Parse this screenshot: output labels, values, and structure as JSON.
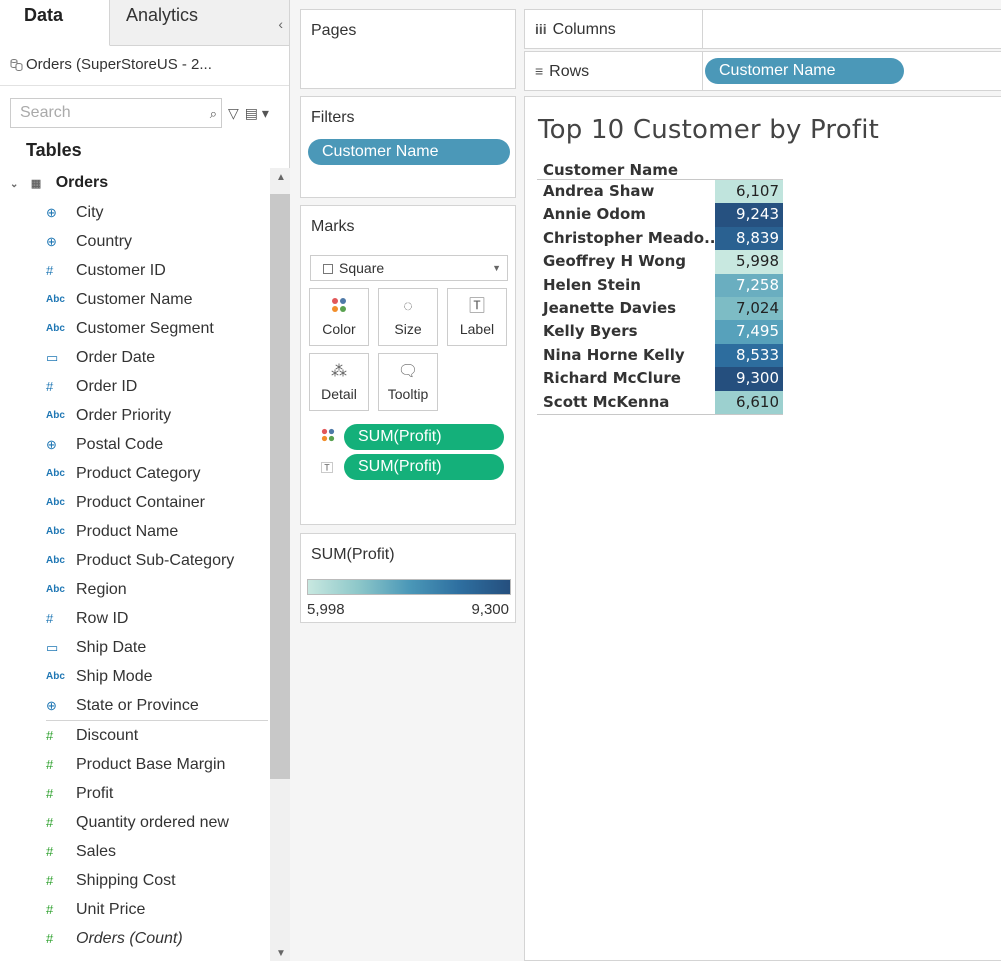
{
  "left_pane": {
    "tabs": [
      {
        "label": "Data",
        "active": true
      },
      {
        "label": "Analytics",
        "active": false
      }
    ],
    "collapse_glyph": "‹",
    "datasource": "Orders (SuperStoreUS - 2...",
    "search": {
      "placeholder": "Search"
    },
    "tables_heading": "Tables",
    "table_name": "Orders",
    "dimensions": [
      {
        "icon": "globe-icon",
        "glyph": "⊕",
        "name": "City"
      },
      {
        "icon": "globe-icon",
        "glyph": "⊕",
        "name": "Country"
      },
      {
        "icon": "number-icon",
        "glyph": "#",
        "name": "Customer ID"
      },
      {
        "icon": "abc-icon",
        "glyph": "Abc",
        "name": "Customer Name"
      },
      {
        "icon": "abc-icon",
        "glyph": "Abc",
        "name": "Customer Segment"
      },
      {
        "icon": "calendar-icon",
        "glyph": "▭",
        "name": "Order Date"
      },
      {
        "icon": "number-icon",
        "glyph": "#",
        "name": "Order ID"
      },
      {
        "icon": "abc-icon",
        "glyph": "Abc",
        "name": "Order Priority"
      },
      {
        "icon": "globe-icon",
        "glyph": "⊕",
        "name": "Postal Code"
      },
      {
        "icon": "abc-icon",
        "glyph": "Abc",
        "name": "Product Category"
      },
      {
        "icon": "abc-icon",
        "glyph": "Abc",
        "name": "Product Container"
      },
      {
        "icon": "abc-icon",
        "glyph": "Abc",
        "name": "Product Name"
      },
      {
        "icon": "abc-icon",
        "glyph": "Abc",
        "name": "Product Sub-Category"
      },
      {
        "icon": "abc-icon",
        "glyph": "Abc",
        "name": "Region"
      },
      {
        "icon": "number-icon",
        "glyph": "#",
        "name": "Row ID"
      },
      {
        "icon": "calendar-icon",
        "glyph": "▭",
        "name": "Ship Date"
      },
      {
        "icon": "abc-icon",
        "glyph": "Abc",
        "name": "Ship Mode"
      },
      {
        "icon": "globe-icon",
        "glyph": "⊕",
        "name": "State or Province"
      }
    ],
    "measures": [
      {
        "icon": "number-icon",
        "glyph": "#",
        "name": "Discount"
      },
      {
        "icon": "number-icon",
        "glyph": "#",
        "name": "Product Base Margin"
      },
      {
        "icon": "number-icon",
        "glyph": "#",
        "name": "Profit"
      },
      {
        "icon": "number-icon",
        "glyph": "#",
        "name": "Quantity ordered new"
      },
      {
        "icon": "number-icon",
        "glyph": "#",
        "name": "Sales"
      },
      {
        "icon": "number-icon",
        "glyph": "#",
        "name": "Shipping Cost"
      },
      {
        "icon": "number-icon",
        "glyph": "#",
        "name": "Unit Price"
      },
      {
        "icon": "number-icon",
        "glyph": "#",
        "name": "Orders (Count)",
        "italic": true
      }
    ]
  },
  "pages": {
    "title": "Pages"
  },
  "filters": {
    "title": "Filters",
    "pill": "Customer Name"
  },
  "marks": {
    "title": "Marks",
    "mark_type": "Square",
    "buttons": [
      {
        "name": "color",
        "label": "Color"
      },
      {
        "name": "size",
        "label": "Size"
      },
      {
        "name": "label",
        "label": "Label"
      },
      {
        "name": "detail",
        "label": "Detail"
      },
      {
        "name": "tooltip",
        "label": "Tooltip"
      }
    ],
    "pills": [
      {
        "type": "color",
        "label": "SUM(Profit)"
      },
      {
        "type": "label",
        "label": "SUM(Profit)"
      }
    ]
  },
  "legend": {
    "title": "SUM(Profit)",
    "min": "5,998",
    "max": "9,300"
  },
  "shelves": {
    "columns_label": "Columns",
    "rows_label": "Rows",
    "rows_pill": "Customer Name"
  },
  "viz": {
    "title": "Top 10 Customer by Profit",
    "column_header": "Customer Name",
    "colors": {
      "low": "#c8e8e0",
      "high": "#254f7e"
    },
    "rows": [
      {
        "name": "Andrea Shaw",
        "value": 6107,
        "label": "6,107"
      },
      {
        "name": "Annie Odom",
        "value": 9243,
        "label": "9,243"
      },
      {
        "name": "Christopher Meado..",
        "value": 8839,
        "label": "8,839"
      },
      {
        "name": "Geoffrey H Wong",
        "value": 5998,
        "label": "5,998"
      },
      {
        "name": "Helen Stein",
        "value": 7258,
        "label": "7,258"
      },
      {
        "name": "Jeanette Davies",
        "value": 7024,
        "label": "7,024"
      },
      {
        "name": "Kelly Byers",
        "value": 7495,
        "label": "7,495"
      },
      {
        "name": "Nina Horne Kelly",
        "value": 8533,
        "label": "8,533"
      },
      {
        "name": "Richard McClure",
        "value": 9300,
        "label": "9,300"
      },
      {
        "name": "Scott McKenna",
        "value": 6610,
        "label": "6,610"
      }
    ]
  }
}
